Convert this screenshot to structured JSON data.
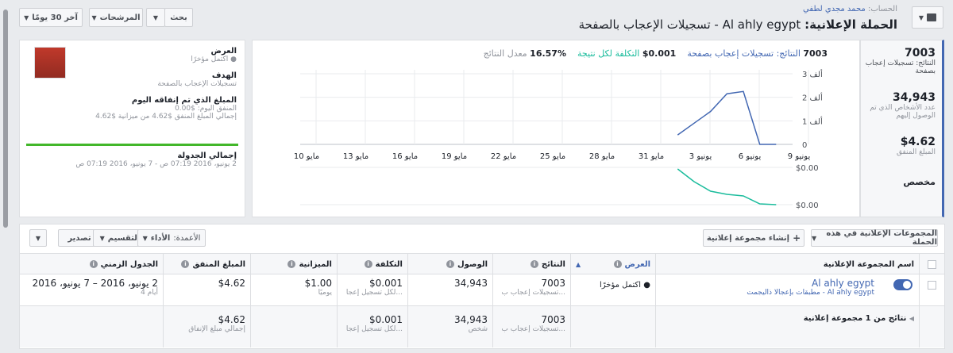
{
  "header": {
    "account_label": "الحساب:",
    "account_name": "محمد مجدي لطفي",
    "campaign_prefix": "الحملة الإعلانية:",
    "campaign_name": "Al ahly egypt - تسجيلات الإعجاب بالصفحة",
    "date_range_label": "آخر 30 يومًا",
    "filters_label": "المرشحات",
    "search_label": "بحث"
  },
  "summary": {
    "results_value": "7003",
    "results_label": "النتائج: تسجيلات إعجاب بصفحة",
    "reach_value": "34,943",
    "reach_label": "عدد الأشخاص الذي تم الوصول إليهم",
    "spent_value": "$4.62",
    "spent_label": "المبلغ المنفق",
    "custom_label": "مخصص"
  },
  "chart_header": {
    "results_count": "7003",
    "results_metric": "النتائج: تسجيلات إعجاب بصفحة",
    "cost_value": "$0.001",
    "cost_label": "التكلفة لكل نتيجة",
    "rate_value": "16.57%",
    "rate_label": "معدل النتائج"
  },
  "chart_data": [
    {
      "type": "line",
      "title": "",
      "x": [
        "10 مايو",
        "13 مايو",
        "16 مايو",
        "19 مايو",
        "22 مايو",
        "25 مايو",
        "28 مايو",
        "31 مايو",
        "3 يونيو",
        "6 يونيو",
        "9 يونيو"
      ],
      "ylim": [
        0,
        3000
      ],
      "yticks": [
        "0",
        "1 ألف",
        "2 ألف",
        "3 ألف"
      ],
      "series": [
        {
          "color": "#4267b2",
          "points": [
            {
              "x": "2016-06-02",
              "y": 400
            },
            {
              "x": "2016-06-03",
              "y": 900
            },
            {
              "x": "2016-06-04",
              "y": 1400
            },
            {
              "x": "2016-06-05",
              "y": 2150
            },
            {
              "x": "2016-06-06",
              "y": 2250
            },
            {
              "x": "2016-06-07",
              "y": 0
            },
            {
              "x": "2016-06-08",
              "y": 0
            }
          ]
        }
      ]
    },
    {
      "type": "line",
      "title": "",
      "ylim": [
        0,
        0
      ],
      "yticks": [
        "$0.00",
        "$0.00"
      ],
      "series": [
        {
          "color": "#1abc9c",
          "points": [
            {
              "x": "2016-06-02",
              "y": 0.0
            },
            {
              "x": "2016-06-03",
              "y": 0.0
            },
            {
              "x": "2016-06-04",
              "y": 0.0
            },
            {
              "x": "2016-06-05",
              "y": 0.0
            },
            {
              "x": "2016-06-06",
              "y": 0.0
            },
            {
              "x": "2016-06-07",
              "y": 0.0
            },
            {
              "x": "2016-06-08",
              "y": 0.0
            }
          ]
        }
      ]
    }
  ],
  "side": {
    "delivery_label": "العرض",
    "delivery_value": "اكتمل مؤخرًا",
    "objective_label": "الهدف",
    "objective_value": "تسجيلات الإعجاب بالصفحة",
    "spent_today_label": "المبلغ الذي تم إنفاقه اليوم",
    "spent_today_value": "المنفق اليوم: $0.00",
    "total_spent_value": "إجمالي المبلغ المنفق $4.62 من ميزانية $4.62",
    "budget_fraction": 1.0,
    "schedule_label": "إجمالي الجدولة",
    "schedule_value": "2 يونيو، 2016 07:19 ص - 7 يونيو، 2016 07:19 ص"
  },
  "toolbar": {
    "adsets_label": "المجموعات الإعلانية في هذه الحملة",
    "create_label": "إنشاء مجموعة إعلانية",
    "columns_label": "الأعمدة:",
    "columns_value": "الأداء",
    "breakdown_label": "التقسيم",
    "export_label": "تصدير"
  },
  "table": {
    "headers": {
      "name": "اسم المجموعة الإعلانية",
      "delivery": "العرض",
      "results": "النتائج",
      "reach": "الوصول",
      "cost": "التكلفة",
      "budget": "الميزانية",
      "spent": "المبلغ المنفق",
      "schedule": "الجدول الزمني"
    },
    "row": {
      "name": "Al ahly egypt",
      "name_sub": "Al ahly egypt - مطبقات بإعجالا ذاليجمت",
      "delivery": "اكتمل مؤخرًا",
      "results": "7003",
      "results_sub": "تسجيلات إعجاب ب...",
      "reach": "34,943",
      "cost": "$0.001",
      "cost_sub": "لكل تسجيل إعجا...",
      "budget": "$1.00",
      "budget_sub": "يوميًا",
      "spent": "$4.62",
      "schedule": "2 يونيو، 2016 – 7 يونيو، 2016",
      "schedule_sub": "4 أيام"
    },
    "totals": {
      "label": "نتائج من 1 مجموعة إعلانية",
      "results": "7003",
      "results_sub": "تسجيلات إعجاب ب...",
      "reach": "34,943",
      "reach_sub": "شخص",
      "cost": "$0.001",
      "cost_sub": "لكل تسجيل إعجا...",
      "spent": "$4.62",
      "spent_sub": "إجمالي مبلغ الإنفاق"
    }
  }
}
